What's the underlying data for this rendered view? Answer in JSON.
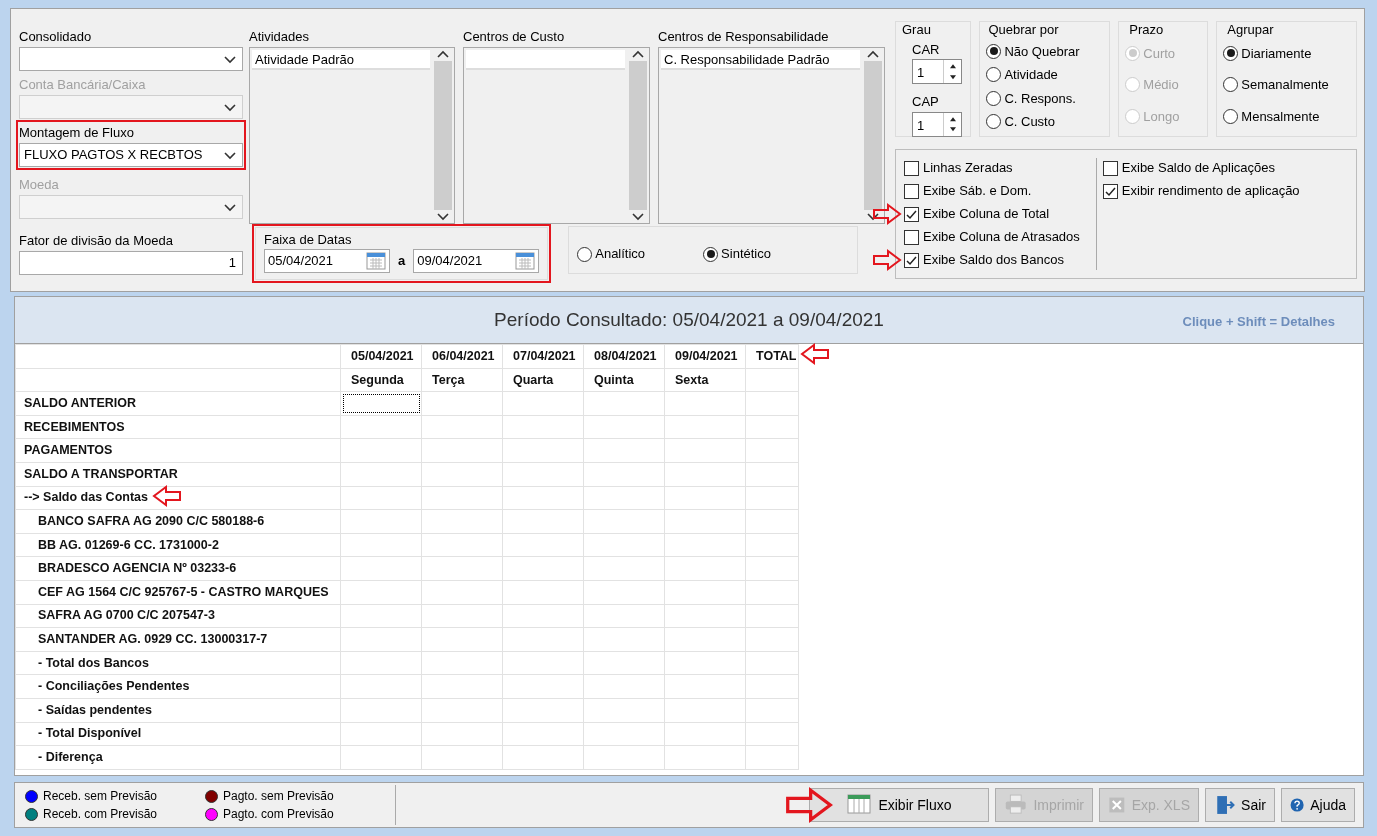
{
  "filters": [
    {
      "kind": "dropdown",
      "label": "Consolidado",
      "disabled": false,
      "highlighted": false
    },
    {
      "kind": "dropdown",
      "label": "Conta Bancária/Caixa",
      "disabled": true,
      "highlighted": false
    },
    {
      "kind": "dropdown",
      "label": "Montagem de Fluxo",
      "value": "FLUXO PAGTOS X RECBTOS",
      "disabled": false,
      "highlighted": true
    },
    {
      "kind": "dropdown",
      "label": "Moeda",
      "disabled": true,
      "highlighted": false
    },
    {
      "kind": "number",
      "label": "Fator de divisão da Moeda",
      "value": "1",
      "disabled": false,
      "highlighted": false
    }
  ],
  "lists": [
    {
      "label": "Atividades",
      "items": [
        "Atividade Padrão"
      ]
    },
    {
      "label": "Centros de Custo"
    },
    {
      "label": "Centros de Responsabilidade",
      "items": [
        "C. Responsabilidade Padrão"
      ]
    }
  ],
  "date_range": {
    "label": "Faixa de Datas",
    "from": "05/04/2021",
    "separator": "a",
    "to": "09/04/2021",
    "highlighted": true
  },
  "mode": [
    {
      "label": "Analítico",
      "selected": false
    },
    {
      "label": "Sintético",
      "selected": true
    }
  ],
  "grau": {
    "label": "Grau",
    "spinners": [
      {
        "label": "CAR",
        "value": "1"
      },
      {
        "label": "CAP",
        "value": "1"
      }
    ]
  },
  "radio_groups": [
    {
      "label": "Quebrar por",
      "options": [
        {
          "label": "Não Quebrar",
          "selected": true,
          "disabled": false
        },
        {
          "label": "Atividade",
          "selected": false,
          "disabled": false
        },
        {
          "label": "C. Respons.",
          "selected": false,
          "disabled": false
        },
        {
          "label": "C. Custo",
          "selected": false,
          "disabled": false
        }
      ]
    },
    {
      "label": "Prazo",
      "options": [
        {
          "label": "Curto",
          "selected": true,
          "disabled": true
        },
        {
          "label": "Médio",
          "selected": false,
          "disabled": true
        },
        {
          "label": "Longo",
          "selected": false,
          "disabled": true
        }
      ]
    },
    {
      "label": "Agrupar",
      "options": [
        {
          "label": "Diariamente",
          "selected": true,
          "disabled": false
        },
        {
          "label": "Semanalmente",
          "selected": false,
          "disabled": false
        },
        {
          "label": "Mensalmente",
          "selected": false,
          "disabled": false
        }
      ]
    }
  ],
  "options": [
    [
      {
        "label": "Linhas Zeradas",
        "checked": false,
        "arrow": false
      },
      {
        "label": "Exibe Sáb. e Dom.",
        "checked": false,
        "arrow": false
      },
      {
        "label": "Exibe Coluna de Total",
        "checked": true,
        "arrow": true
      },
      {
        "label": "Exibe Coluna de Atrasados",
        "checked": false,
        "arrow": false
      },
      {
        "label": "Exibe Saldo dos Bancos",
        "checked": true,
        "arrow": true
      }
    ],
    [
      {
        "label": "Exibe Saldo de Aplicações",
        "checked": false,
        "arrow": false
      },
      {
        "label": "Exibir rendimento de aplicação",
        "checked": true,
        "arrow": false
      }
    ]
  ],
  "banner": {
    "title": "Período Consultado: 05/04/2021 a 09/04/2021",
    "hint": "Clique + Shift = Detalhes"
  },
  "grid": {
    "columns": [
      {
        "date": "05/04/2021",
        "weekday": "Segunda"
      },
      {
        "date": "06/04/2021",
        "weekday": "Terça"
      },
      {
        "date": "07/04/2021",
        "weekday": "Quarta"
      },
      {
        "date": "08/04/2021",
        "weekday": "Quinta"
      },
      {
        "date": "09/04/2021",
        "weekday": "Sexta"
      }
    ],
    "total": {
      "label": "TOTAL",
      "arrow": true
    },
    "rows": [
      {
        "label": "SALDO ANTERIOR",
        "arrow": false
      },
      {
        "label": "RECEBIMENTOS",
        "arrow": false
      },
      {
        "label": "PAGAMENTOS",
        "arrow": false
      },
      {
        "label": "SALDO A TRANSPORTAR",
        "arrow": false
      },
      {
        "label": "--> Saldo das Contas",
        "arrow": true,
        "children": [
          {
            "label": "BANCO SAFRA AG 2090 C/C 580188-6",
            "arrow": false
          },
          {
            "label": "BB AG. 01269-6 CC. 1731000-2",
            "arrow": false
          },
          {
            "label": "BRADESCO AGENCIA Nº 03233-6",
            "arrow": false
          },
          {
            "label": "CEF AG 1564 C/C 925767-5 - CASTRO MARQUES",
            "arrow": false
          },
          {
            "label": "SAFRA AG 0700 C/C 207547-3",
            "arrow": false
          },
          {
            "label": "SANTANDER AG. 0929 CC. 13000317-7",
            "arrow": false
          },
          {
            "label": "- Total dos Bancos",
            "arrow": false
          },
          {
            "label": "- Conciliações Pendentes",
            "arrow": false
          },
          {
            "label": "- Saídas pendentes",
            "arrow": false
          },
          {
            "label": "- Total Disponível",
            "arrow": false
          },
          {
            "label": "- Diferença",
            "arrow": false
          }
        ]
      }
    ]
  },
  "legend": [
    [
      {
        "label": "Receb. sem Previsão",
        "color": "#0000ff"
      },
      {
        "label": "Receb. com Previsão",
        "color": "#008080"
      }
    ],
    [
      {
        "label": "Pagto. sem Previsão",
        "color": "#800000"
      },
      {
        "label": "Pagto. com Previsão",
        "color": "#ff00ff"
      }
    ]
  ],
  "buttons": [
    {
      "kind": "grid",
      "label": "Exibir Fluxo",
      "disabled": false,
      "arrow": true
    },
    {
      "kind": "print",
      "label": "Imprimir",
      "disabled": true,
      "arrow": false
    },
    {
      "kind": "excel",
      "label": "Exp. XLS",
      "disabled": true,
      "arrow": false
    },
    {
      "kind": "exit",
      "label": "Sair",
      "disabled": false,
      "arrow": false
    },
    {
      "kind": "help",
      "label": "Ajuda",
      "disabled": false,
      "arrow": false
    }
  ]
}
